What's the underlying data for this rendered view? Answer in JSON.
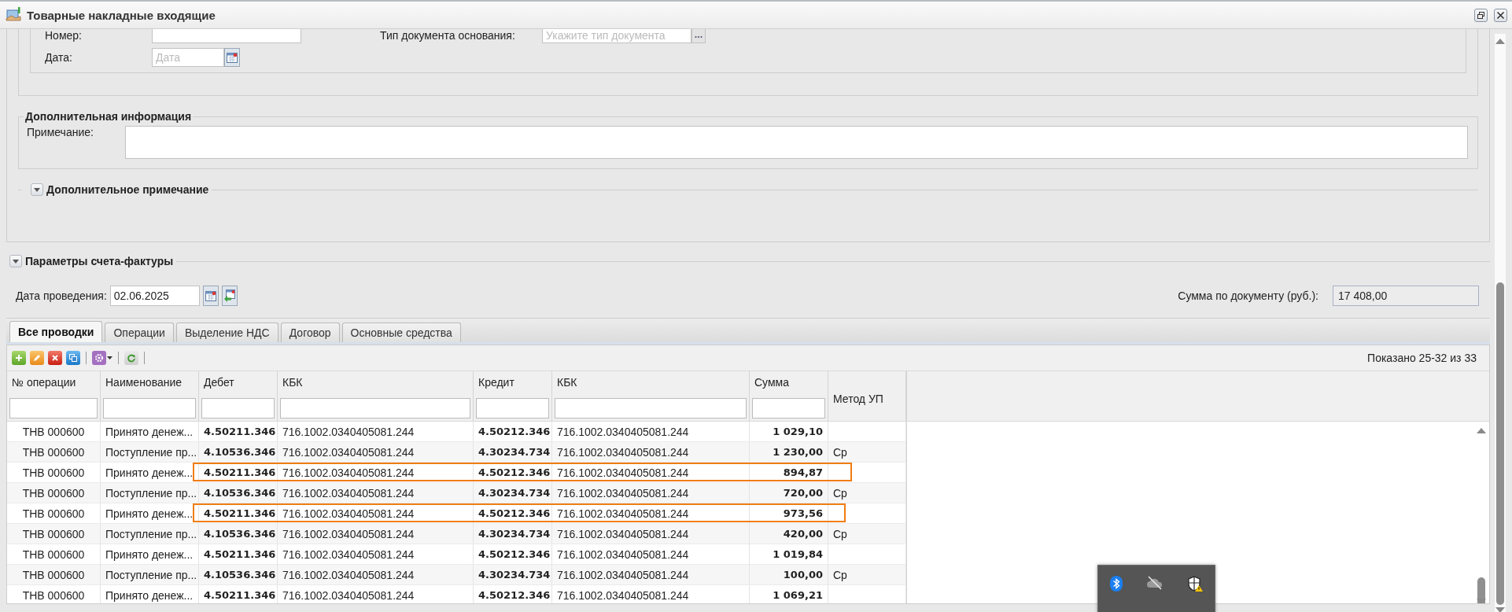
{
  "window": {
    "title": "Товарные накладные входящие"
  },
  "document_section": {
    "fields": [
      {
        "label": "Номер:"
      },
      {
        "label": "Тип документа основания:",
        "placeholder": "Укажите тип документа"
      },
      {
        "label": "Дата:",
        "placeholder": "Дата"
      }
    ]
  },
  "additional_info": {
    "title": "Дополнительная информация",
    "note_label": "Примечание:"
  },
  "additional_note": {
    "title": "Дополнительное примечание"
  },
  "invoice_params": {
    "title": "Параметры счета-фактуры"
  },
  "posting_date": {
    "label": "Дата проведения:",
    "value": "02.06.2025"
  },
  "document_sum": {
    "label": "Сумма по документу (руб.):",
    "value": "17 408,00"
  },
  "tabs": [
    {
      "label": "Все проводки",
      "selected": true
    },
    {
      "label": "Операции",
      "selected": false
    },
    {
      "label": "Выделение НДС",
      "selected": false
    },
    {
      "label": "Договор",
      "selected": false
    },
    {
      "label": "Основные средства",
      "selected": false
    }
  ],
  "grid": {
    "paging": "Показано 25-32 из 33",
    "columns": [
      {
        "title": "№ операции",
        "kind": "code",
        "filter": true
      },
      {
        "title": "Наименование",
        "kind": "text",
        "filter": true
      },
      {
        "title": "Дебет",
        "kind": "account",
        "filter": true
      },
      {
        "title": "КБК",
        "kind": "text",
        "filter": true
      },
      {
        "title": "Кредит",
        "kind": "account",
        "filter": true
      },
      {
        "title": "КБК",
        "kind": "text",
        "filter": true
      },
      {
        "title": "Сумма",
        "kind": "amount",
        "filter": true
      },
      {
        "title": "Метод УП",
        "kind": "text",
        "filter": false
      }
    ],
    "rows": [
      {
        "highlighted": false,
        "cells": [
          "ТНВ 000600",
          "Принято денеж...",
          "4.50211.346",
          "716.1002.0340405081.244",
          "4.50212.346",
          "716.1002.0340405081.244",
          "1 029,10",
          ""
        ]
      },
      {
        "highlighted": false,
        "cells": [
          "ТНВ 000600",
          "Поступление пр...",
          "4.10536.346",
          "716.1002.0340405081.244",
          "4.30234.734",
          "716.1002.0340405081.244",
          "1 230,00",
          "Ср"
        ]
      },
      {
        "highlighted": true,
        "cells": [
          "ТНВ 000600",
          "Принято денеж...",
          "4.50211.346",
          "716.1002.0340405081.244",
          "4.50212.346",
          "716.1002.0340405081.244",
          "894,87",
          ""
        ]
      },
      {
        "highlighted": false,
        "cells": [
          "ТНВ 000600",
          "Поступление пр...",
          "4.10536.346",
          "716.1002.0340405081.244",
          "4.30234.734",
          "716.1002.0340405081.244",
          "720,00",
          "Ср"
        ]
      },
      {
        "highlighted": true,
        "cells": [
          "ТНВ 000600",
          "Принято денеж...",
          "4.50211.346",
          "716.1002.0340405081.244",
          "4.50212.346",
          "716.1002.0340405081.244",
          "973,56",
          ""
        ]
      },
      {
        "highlighted": false,
        "cells": [
          "ТНВ 000600",
          "Поступление пр...",
          "4.10536.346",
          "716.1002.0340405081.244",
          "4.30234.734",
          "716.1002.0340405081.244",
          "420,00",
          "Ср"
        ]
      },
      {
        "highlighted": false,
        "cells": [
          "ТНВ 000600",
          "Принято денеж...",
          "4.50211.346",
          "716.1002.0340405081.244",
          "4.50212.346",
          "716.1002.0340405081.244",
          "1 019,84",
          ""
        ]
      },
      {
        "highlighted": false,
        "cells": [
          "ТНВ 000600",
          "Поступление пр...",
          "4.10536.346",
          "716.1002.0340405081.244",
          "4.30234.734",
          "716.1002.0340405081.244",
          "100,00",
          "Ср"
        ]
      },
      {
        "highlighted": false,
        "cells": [
          "ТНВ 000600",
          "Принято денеж...",
          "4.50211.346",
          "716.1002.0340405081.244",
          "4.50212.346",
          "716.1002.0340405081.244",
          "1 069,21",
          ""
        ]
      }
    ]
  }
}
